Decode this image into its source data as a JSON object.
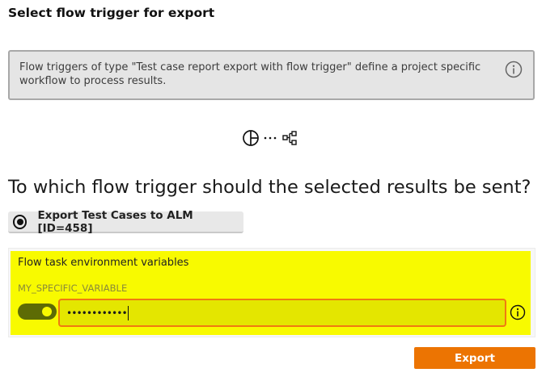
{
  "dialog": {
    "title": "Select flow trigger for export"
  },
  "info": {
    "text": "Flow triggers of type \"Test case report export with flow trigger\" define a project specific workflow to process results."
  },
  "question": "To which flow trigger should the selected results be sent?",
  "triggers": [
    {
      "label": "Export Test Cases to ALM [ID=458]",
      "selected": true
    }
  ],
  "env_vars": {
    "title": "Flow task environment variables",
    "variables": [
      {
        "name": "MY_SPECIFIC_VARIABLE",
        "value": "••••••••••••",
        "enabled": true
      }
    ]
  },
  "actions": {
    "export_label": "Export"
  },
  "colors": {
    "accent": "#ec7402",
    "highlight": "#f8fa00",
    "input_border": "#f07a10",
    "toggle": "#5d6b05"
  },
  "icons": [
    "info-icon",
    "report-icon",
    "flow-icon",
    "info-icon"
  ]
}
